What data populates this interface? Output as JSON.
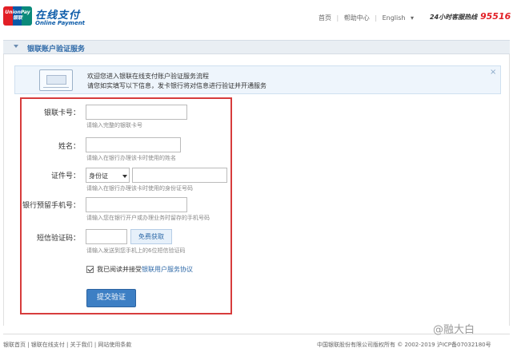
{
  "header": {
    "logo_text": "UnionPay 银联",
    "title": "在线支付",
    "subtitle": "Online Payment",
    "nav": [
      "首页",
      "帮助中心",
      "English"
    ],
    "hotline_label": "24小时客服热线",
    "hotline_number": "95516"
  },
  "section": {
    "title": "银联账户验证服务"
  },
  "notice": {
    "line1": "欢迎您进入银联在线支付账户验证服务流程",
    "line2": "请您如实填写以下信息，发卡银行将对信息进行验证并开通服务",
    "close": "×"
  },
  "form": {
    "card_label": "银联卡号：",
    "card_hint": "请输入完整的银联卡号",
    "name_label": "姓名：",
    "name_hint": "请输入在银行办理该卡时使用的姓名",
    "id_label": "证件号：",
    "id_type": "身份证",
    "id_hint": "请输入在银行办理该卡时使用的身份证号码",
    "phone_label": "银行预留手机号：",
    "phone_hint": "请输入您在银行开户或办理业务时留存的手机号码",
    "sms_label": "短信验证码：",
    "sms_button": "免费获取",
    "sms_hint": "请输入发送到您手机上的6位短信验证码",
    "agree_text": "我已阅读并接受",
    "agree_link": "银联用户服务协议",
    "submit": "提交验证"
  },
  "footer": {
    "links": "银联首页 | 银联在线支付 | 关于我们 | 网站使用条款",
    "copyright": "中国银联股份有限公司版权所有 © 2002-2019 沪ICP备07032180号"
  },
  "watermark": "@融大白"
}
